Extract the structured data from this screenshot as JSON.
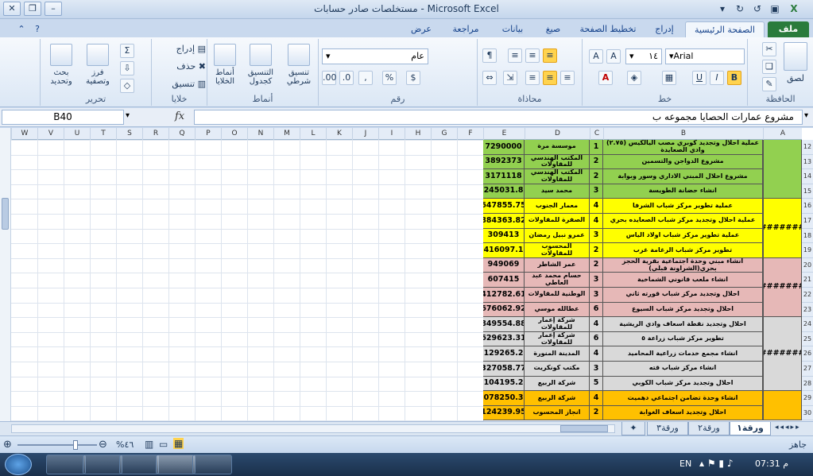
{
  "window": {
    "title": "مستخلصات صادر حسابات  -  Microsoft Excel"
  },
  "tabs": [
    "ملف",
    "الصفحة الرئيسية",
    "إدراج",
    "تخطيط الصفحة",
    "صيغ",
    "بيانات",
    "مراجعة",
    "عرض"
  ],
  "ribbon": {
    "clipboard": {
      "label": "الحافظة",
      "paste": "لصق"
    },
    "font": {
      "label": "خط",
      "name": "Arial",
      "size": "١٤",
      "bold": "B",
      "italic": "I",
      "underline": "U"
    },
    "alignment": {
      "label": "محاذاة"
    },
    "number": {
      "label": "رقم",
      "format": "عام",
      "percent": "%"
    },
    "styles": {
      "label": "أنماط",
      "conditional": "تنسيق شرطي",
      "table": "التنسيق كجدول",
      "cell": "أنماط الخلايا"
    },
    "cells": {
      "label": "خلايا",
      "insert": "إدراج",
      "delete": "حذف",
      "format": "تنسيق"
    },
    "editing": {
      "label": "تحرير",
      "sort": "فرز وتصفية",
      "find": "بحث وتحديد"
    }
  },
  "formula_bar": {
    "name_box": "B40",
    "fx": "fx",
    "content": "مشروع عمارات الحصايا مجموعه ب"
  },
  "columns": [
    "W",
    "V",
    "U",
    "T",
    "S",
    "R",
    "Q",
    "P",
    "O",
    "N",
    "M",
    "L",
    "K",
    "J",
    "I",
    "H",
    "G",
    "F",
    "E",
    "D",
    "C",
    "B",
    "A"
  ],
  "rows": [
    "12",
    "13",
    "14",
    "15",
    "16",
    "17",
    "18",
    "19",
    "20",
    "21",
    "22",
    "23",
    "24",
    "25",
    "26",
    "27",
    "28",
    "29",
    "30"
  ],
  "table": [
    {
      "b": "عملية احلال وتجديد كوبري مصب اليالكيس (٢.٧٥) وادي الصعايدة",
      "c": "1",
      "d": "موسسة مرة",
      "e": "7290000"
    },
    {
      "b": "مشروع الدواجن والتسمين",
      "c": "2",
      "d": "المكتب الهندسي للمقاولات",
      "e": "3892373"
    },
    {
      "b": "مشروع احلال المبني الاداري وسور وبوابة",
      "c": "2",
      "d": "المكتب الهندسي للمقاولات",
      "e": "3171118"
    },
    {
      "b": "انشاء حضانة الطويسة",
      "c": "3",
      "d": "محمد سيد",
      "e": "245031.8"
    },
    {
      "b": "عملية تطوير مركز شباب الشرفا",
      "c": "4",
      "d": "معمار الجنوب",
      "e": "647855.75"
    },
    {
      "b": "عملية احلال وتجديد مركز شباب الصعايده بحري",
      "c": "4",
      "d": "الصفرة للمقاولات",
      "e": "884363.82"
    },
    {
      "b": "عملية تطوير مركز شباب اولاد الياس",
      "c": "3",
      "d": "عمرو نبيل رمضان",
      "e": "309413"
    },
    {
      "b": "تطوير مركز شباب الرغامة غرب",
      "c": "2",
      "d": "المحسوب للمقاولات",
      "e": "1416097.11"
    },
    {
      "b": "انشاء مبني وحدة اجتماعية بقرية الحجز بحري(الشراونة قبلي)",
      "c": "2",
      "d": "عمر الشاطر",
      "e": "949069"
    },
    {
      "b": "انشاء ملعب قانوني الشماخية",
      "c": "3",
      "d": "حسام محمد عبد العاطي",
      "e": "607415"
    },
    {
      "b": "احلال وتجديد مركز شباب قورته ثاني",
      "c": "3",
      "d": "الوطنية للمقاولات",
      "e": "412782.61"
    },
    {
      "b": "احلال وتجديد مركز شباب السيوع",
      "c": "6",
      "d": "عطالله موسي",
      "e": "676062.92"
    },
    {
      "b": "احلال وتجديد نقطة اسعاف وادي الريشية",
      "c": "4",
      "d": "شركة إعمار للمقاولات",
      "e": "849554.88"
    },
    {
      "b": "تطوير مركز شباب زراعة ٥",
      "c": "6",
      "d": "شركة إعمار للمقاولات",
      "e": "629623.31"
    },
    {
      "b": "انشاء مجمع خدمات زراعية المحاميد",
      "c": "4",
      "d": "المدينة المنورة",
      "e": "129265.2"
    },
    {
      "b": "انشاء مركز شباب قته",
      "c": "3",
      "d": "مكتب كونكريت",
      "e": "327058.77"
    },
    {
      "b": "احلال وتجديد مركز شباب الكوبي",
      "c": "5",
      "d": "شركة الربيع",
      "e": "1104195.28"
    },
    {
      "b": "انشاء وحدة تضامن اجتماعي دهميت",
      "c": "4",
      "d": "شركة الربيع",
      "e": "1078250.38"
    },
    {
      "b": "احلال وتجديد اسعاف الغوابة",
      "c": "2",
      "d": "انجاز المحسوب",
      "e": "124239.95"
    }
  ],
  "a_groups": [
    {
      "text": "",
      "color": "#92d050"
    },
    {
      "text": "#########",
      "color": "#ffff00"
    },
    {
      "text": "#########",
      "color": "#e6b8b7"
    },
    {
      "text": "#########",
      "color": "#d9d9d9"
    },
    {
      "text": "",
      "color": "#ffc000"
    }
  ],
  "sheet_tabs": [
    "ورقة١",
    "ورقة٢",
    "ورقة٣"
  ],
  "status": {
    "ready": "جاهز",
    "zoom": "%٤٦"
  },
  "taskbar": {
    "lang": "EN",
    "time": "07:31 م"
  }
}
